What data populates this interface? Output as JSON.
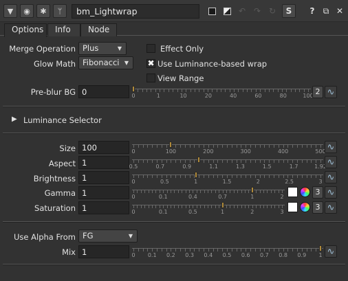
{
  "titlebar": {
    "node_name": "bm_Lightwrap"
  },
  "tabs": [
    {
      "label": "Options"
    },
    {
      "label": "Info"
    },
    {
      "label": "Node"
    }
  ],
  "merge_operation": {
    "label": "Merge Operation",
    "value": "Plus"
  },
  "glow_math": {
    "label": "Glow Math",
    "value": "Fibonacci"
  },
  "effect_only": {
    "label": "Effect Only",
    "checked": false
  },
  "use_luminance": {
    "label": "Use Luminance-based wrap",
    "checked": true
  },
  "view_range": {
    "label": "View Range",
    "checked": false
  },
  "preblur": {
    "label": "Pre-blur BG",
    "value": "0",
    "button_label": "2",
    "ticks": [
      "0",
      "1",
      "10",
      "20",
      "40",
      "60",
      "80",
      "100"
    ],
    "level": 0
  },
  "luminance_selector": {
    "label": "Luminance Selector"
  },
  "size": {
    "label": "Size",
    "value": "100",
    "ticks": [
      "0",
      "100",
      "200",
      "300",
      "400",
      "500"
    ],
    "level": 100
  },
  "aspect": {
    "label": "Aspect",
    "value": "1",
    "ticks": [
      "0.5",
      "0.7",
      "0.9",
      "1.1",
      "1.3",
      "1.5",
      "1.7",
      "1.92"
    ],
    "level": 1
  },
  "brightness": {
    "label": "Brightness",
    "value": "1",
    "ticks": [
      "0",
      "0.5",
      "1",
      "1.5",
      "2",
      "2.5",
      "3"
    ],
    "level": 1
  },
  "gamma": {
    "label": "Gamma",
    "value": "1",
    "channels_label": "3",
    "ticks": [
      "0",
      "0.1",
      "0.4",
      "0.7",
      "1",
      "2"
    ],
    "level": 1
  },
  "saturation": {
    "label": "Saturation",
    "value": "1",
    "channels_label": "3",
    "ticks": [
      "0",
      "0.1",
      "0.5",
      "1",
      "2",
      "3"
    ],
    "level": 1
  },
  "use_alpha_from": {
    "label": "Use Alpha From",
    "value": "FG"
  },
  "mix": {
    "label": "Mix",
    "value": "1",
    "ticks": [
      "0",
      "0.1",
      "0.2",
      "0.3",
      "0.4",
      "0.5",
      "0.6",
      "0.7",
      "0.8",
      "0.9",
      "1"
    ],
    "level": 1
  },
  "colors": {
    "accent_handle": "#b08a3a",
    "curve_icon": "#9fc0d8"
  }
}
